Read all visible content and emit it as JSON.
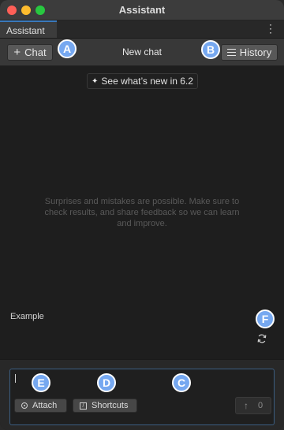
{
  "window": {
    "title": "Assistant",
    "tab_label": "Assistant",
    "menu_icon": "kebab-menu-icon"
  },
  "toolbar": {
    "new_chat_label": "Chat",
    "new_chat_icon": "plus-icon",
    "chat_title": "New chat",
    "history_label": "History",
    "history_icon": "hamburger-icon"
  },
  "body": {
    "whats_new_label": "See what’s new in 6.2",
    "whats_new_icon": "sparkle-icon",
    "disclaimer": "Surprises and mistakes are possible. Make sure to check results, and share feedback so we can learn and improve.",
    "example_label": "Example",
    "refresh_icon": "refresh-icon"
  },
  "input": {
    "placeholder": "",
    "attach_label": "Attach",
    "attach_icon": "attach-icon",
    "shortcuts_label": "Shortcuts",
    "shortcuts_icon": "slash-command-icon",
    "send_icon": "up-arrow-icon",
    "send_count": "0"
  },
  "callouts": {
    "a": "A",
    "b": "B",
    "c": "C",
    "d": "D",
    "e": "E",
    "f": "F"
  },
  "colors": {
    "accent": "#76a8f0",
    "tab_highlight": "#3a79bb",
    "input_border": "#3c5e82",
    "traffic_red": "#fe5f57",
    "traffic_yellow": "#febc2e",
    "traffic_green": "#28c840"
  }
}
